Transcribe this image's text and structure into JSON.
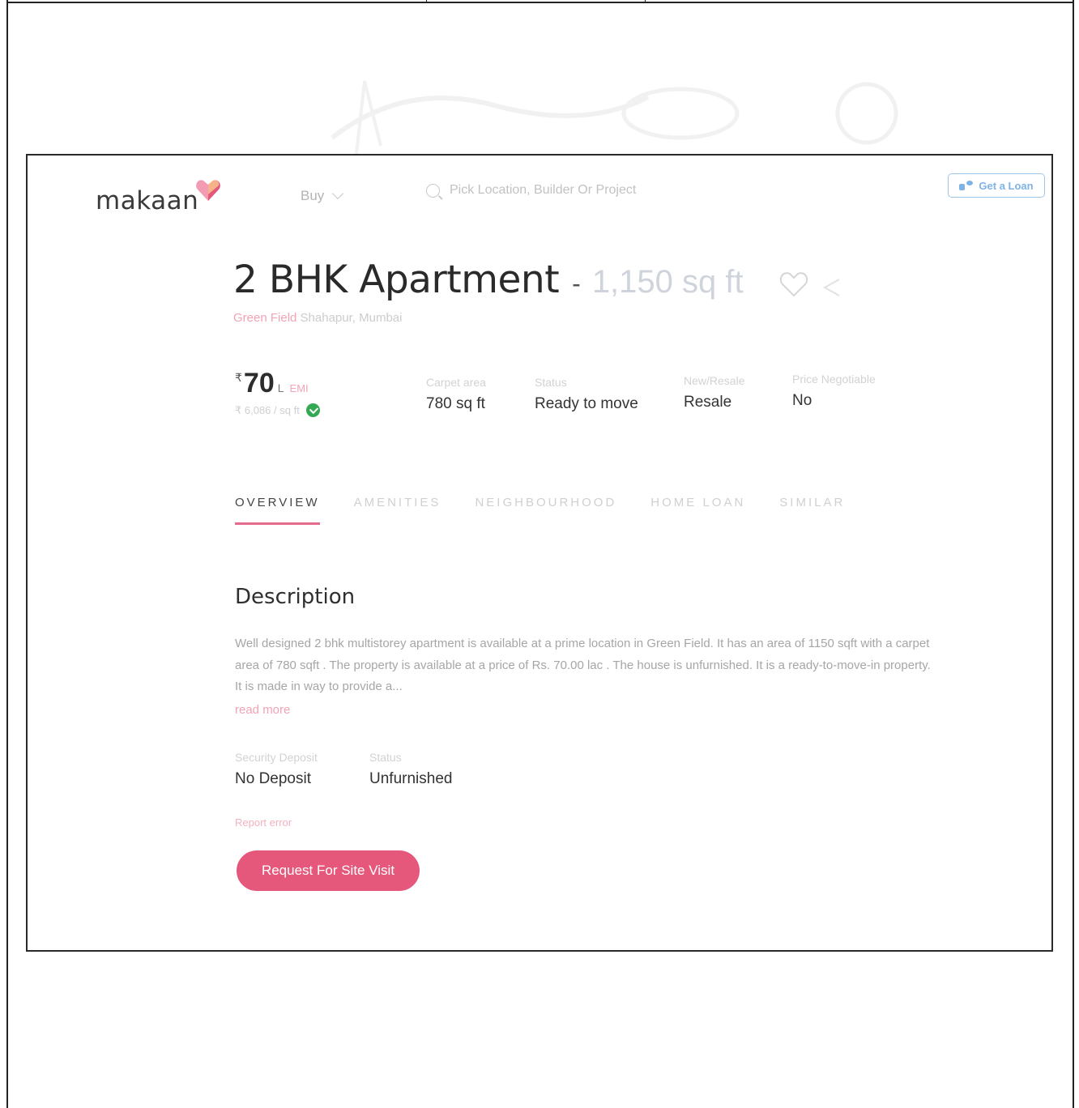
{
  "header": {
    "logo_text": "makaan",
    "nav_buy": "Buy",
    "search_placeholder": "Pick Location, Builder Or Project",
    "loan_label": "Get a Loan"
  },
  "listing": {
    "title": "2 BHK Apartment",
    "separator": "-",
    "area": "1,150 sq ft",
    "locality_accent": "Green Field",
    "locality_rest": "Shahapur, Mumbai"
  },
  "price": {
    "currency_symbol": "₹",
    "value": "70",
    "unit": "L",
    "emi_label": "EMI",
    "rate": "₹ 6,086 / sq ft"
  },
  "specs": [
    {
      "label": "Carpet area",
      "value": "780 sq ft"
    },
    {
      "label": "Status",
      "value": "Ready to move"
    },
    {
      "label": "New/Resale",
      "value": "Resale"
    },
    {
      "label": "Price Negotiable",
      "value": "No"
    }
  ],
  "tabs": [
    "OVERVIEW",
    "AMENITIES",
    "NEIGHBOURHOOD",
    "HOME LOAN",
    "SIMILAR"
  ],
  "description": {
    "title": "Description",
    "text": "Well designed 2 bhk multistorey apartment is available at a prime location in Green Field. It has an area of 1150 sqft with a carpet area of 780 sqft . The property is available at a price of Rs. 70.00 lac . The house is unfurnished. It is a ready-to-move-in property. It is made in way to provide a...",
    "read_more": "read more"
  },
  "details": [
    {
      "label": "Security Deposit",
      "value": "No Deposit"
    },
    {
      "label": "Status",
      "value": "Unfurnished"
    }
  ],
  "report_error": "Report error",
  "cta_label": "Request For Site Visit",
  "colors": {
    "brand_pink": "#e5577b",
    "accent_blue": "#7fb2e6",
    "success_green": "#34a853"
  }
}
